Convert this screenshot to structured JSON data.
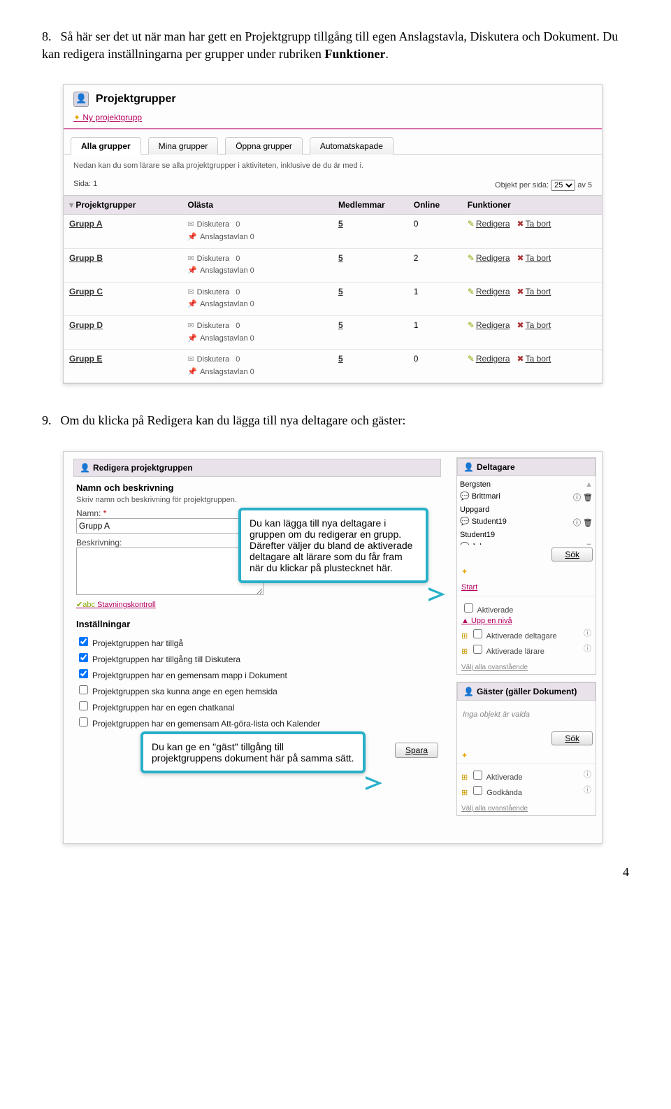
{
  "doc": {
    "step8_num": "8.",
    "step8_text": "Så här ser det ut när man har gett en Projektgrupp tillgång till egen Anslagstavla, Diskutera och Dokument. Du kan redigera inställningarna per grupper under rubriken ",
    "step8_bold": "Funktioner",
    "step8_end": ".",
    "step9_num": "9.",
    "step9_text": "Om du klicka på Redigera kan du lägga till nya deltagare och gäster:",
    "page_number": "4"
  },
  "shot1": {
    "title": "Projektgrupper",
    "new_link": "Ny projektgrupp",
    "tabs": [
      "Alla grupper",
      "Mina grupper",
      "Öppna grupper",
      "Automatskapade"
    ],
    "info": "Nedan kan du som lärare se alla projektgrupper i aktiviteten, inklusive de du är med i.",
    "pager_left": "Sida: 1",
    "pager_right_label": "Objekt per sida:",
    "pager_select": "25",
    "pager_right_of": "av 5",
    "headers": [
      "Projektgrupper",
      "Olästa",
      "Medlemmar",
      "Online",
      "Funktioner"
    ],
    "sub_diskutera": "Diskutera",
    "sub_anslag": "Anslagstavlan",
    "fn_edit": "Redigera",
    "fn_del": "Ta bort",
    "rows": [
      {
        "name": "Grupp A",
        "d": "0",
        "a": "0",
        "m": "5",
        "o": "0"
      },
      {
        "name": "Grupp B",
        "d": "0",
        "a": "0",
        "m": "5",
        "o": "2"
      },
      {
        "name": "Grupp C",
        "d": "0",
        "a": "0",
        "m": "5",
        "o": "1"
      },
      {
        "name": "Grupp D",
        "d": "0",
        "a": "0",
        "m": "5",
        "o": "1"
      },
      {
        "name": "Grupp E",
        "d": "0",
        "a": "0",
        "m": "5",
        "o": "0"
      }
    ]
  },
  "shot2": {
    "edit_title": "Redigera projektgruppen",
    "name_desc_head": "Namn och beskrivning",
    "name_desc_sub": "Skriv namn och beskrivning för projektgruppen.",
    "name_label": "Namn:",
    "name_value": "Grupp A",
    "desc_label": "Beskrivning:",
    "spell": "Stavningskontroll",
    "settings_head": "Inställningar",
    "settings": [
      {
        "checked": true,
        "label": "Projektgruppen har tillgå"
      },
      {
        "checked": true,
        "label": "Projektgruppen har tillgång till Diskutera"
      },
      {
        "checked": true,
        "label": "Projektgruppen har en gemensam mapp i Dokument"
      },
      {
        "checked": false,
        "label": "Projektgruppen ska kunna ange en egen hemsida"
      },
      {
        "checked": false,
        "label": "Projektgruppen har en egen chatkanal"
      },
      {
        "checked": false,
        "label": "Projektgruppen har en gemensam Att-göra-lista och Kalender"
      }
    ],
    "save": "Spara",
    "deltagare_head": "Deltagare",
    "deltagare": [
      "Bergsten",
      "Brittmari",
      "Uppgard",
      "Student19",
      "Student19",
      "Johanna"
    ],
    "sok": "Sök",
    "start": "Start",
    "aktiverade_cb": "Aktiverade",
    "upp": "Upp en nivå",
    "akt_delt": "Aktiverade deltagare",
    "akt_lar": "Aktiverade lärare",
    "valj": "Välj alla ovanstående",
    "gaster_head": "Gäster (gäller Dokument)",
    "inga": "Inga objekt är valda",
    "aktiverade2": "Aktiverade",
    "godkanda": "Godkända",
    "callout1": "Du kan lägga till nya deltagare i gruppen om du redigerar en grupp. Därefter väljer du bland de aktiverade deltagare alt lärare som du får fram när du klickar på plustecknet här.",
    "callout2": "Du kan ge en \"gäst\" tillgång till projektgruppens dokument här på samma sätt."
  }
}
